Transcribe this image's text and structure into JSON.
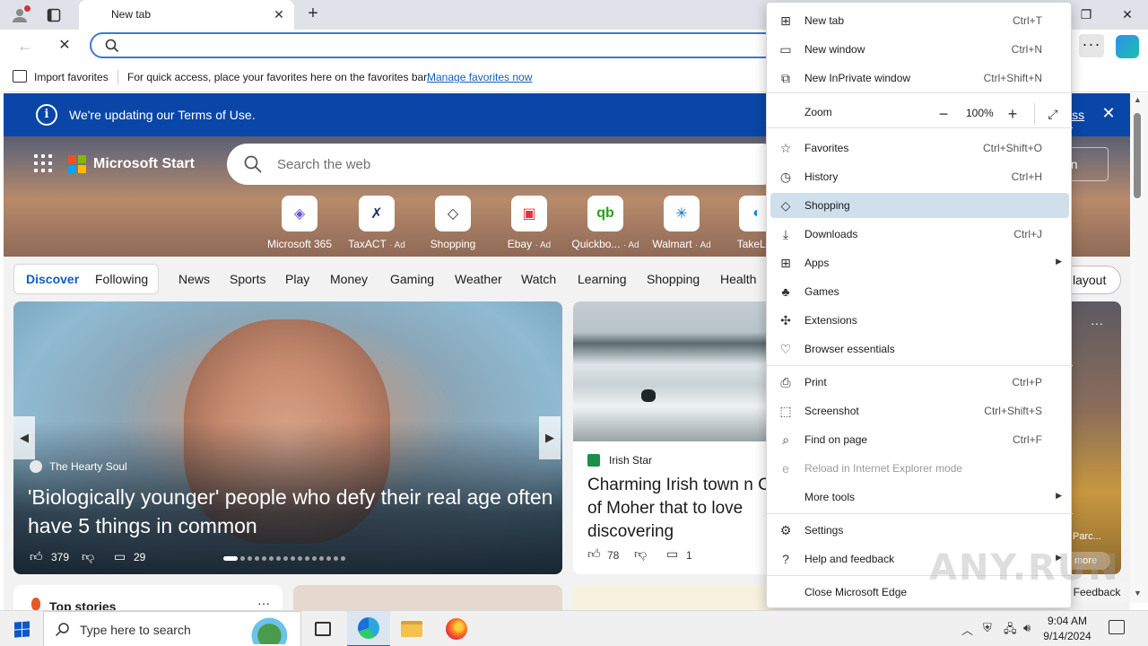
{
  "browser": {
    "tab_title": "New tab",
    "address_value": "",
    "more_label": "···"
  },
  "favorites_bar": {
    "import_label": "Import favorites",
    "hint": "For quick access, place your favorites here on the favorites bar.",
    "manage_link": "Manage favorites now"
  },
  "terms_banner": {
    "text": "We're updating our Terms of Use.",
    "dismiss": "iss"
  },
  "ms_start": {
    "title": "Microsoft Start",
    "search_placeholder": "Search the web",
    "signin": "n in"
  },
  "quick_links": [
    {
      "label": "Microsoft 365",
      "ad": "",
      "glyph": "◈",
      "color": "#6b53d6"
    },
    {
      "label": "TaxACT",
      "ad": "· Ad",
      "glyph": "✗",
      "color": "#13335b"
    },
    {
      "label": "Shopping",
      "ad": "",
      "glyph": "◇",
      "color": "#333333"
    },
    {
      "label": "Ebay",
      "ad": "· Ad",
      "glyph": "▣",
      "color": "#e53238"
    },
    {
      "label": "Quickbo...",
      "ad": "· Ad",
      "glyph": "qb",
      "color": "#2ca01c"
    },
    {
      "label": "Walmart",
      "ad": "· Ad",
      "glyph": "✳",
      "color": "#0071ce"
    },
    {
      "label": "TakeLes",
      "ad": "",
      "glyph": "◐",
      "color": "#1e88e5"
    }
  ],
  "feed_nav": {
    "discover": "Discover",
    "following": "Following",
    "categories": [
      "News",
      "Sports",
      "Play",
      "Money",
      "Gaming",
      "Weather",
      "Watch",
      "Learning",
      "Shopping",
      "Health"
    ],
    "layout_btn": "l layout"
  },
  "hero_card": {
    "source": "The Hearty Soul",
    "title": "'Biologically younger' people who defy their real age often have 5 things in common",
    "likes": "379",
    "comments": "29",
    "slide_count": 16,
    "active_slide": 1
  },
  "card2": {
    "source": "Irish Star",
    "title": "Charming Irish town n Cliffs of Moher that to love discovering",
    "likes": "78",
    "comments": "1"
  },
  "card3": {
    "label": "Parc...",
    "more": "more"
  },
  "bottom": {
    "top_stories": "Top stories",
    "feedback": "Feedback"
  },
  "menu": {
    "items": [
      {
        "label": "New tab",
        "shortcut": "Ctrl+T",
        "icon": "new-tab-icon",
        "glyph": "⊞"
      },
      {
        "label": "New window",
        "shortcut": "Ctrl+N",
        "icon": "new-window-icon",
        "glyph": "▭"
      },
      {
        "label": "New InPrivate window",
        "shortcut": "Ctrl+Shift+N",
        "icon": "inprivate-icon",
        "glyph": "⧉"
      },
      {
        "label": "Zoom",
        "shortcut": "",
        "icon": "",
        "glyph": ""
      },
      {
        "label": "Favorites",
        "shortcut": "Ctrl+Shift+O",
        "icon": "favorites-icon",
        "glyph": "☆"
      },
      {
        "label": "History",
        "shortcut": "Ctrl+H",
        "icon": "history-icon",
        "glyph": "◷"
      },
      {
        "label": "Shopping",
        "shortcut": "",
        "icon": "shopping-tag-icon",
        "glyph": "◇"
      },
      {
        "label": "Downloads",
        "shortcut": "Ctrl+J",
        "icon": "downloads-icon",
        "glyph": "⤓"
      },
      {
        "label": "Apps",
        "shortcut": "",
        "icon": "apps-icon",
        "glyph": "⊞"
      },
      {
        "label": "Games",
        "shortcut": "",
        "icon": "games-icon",
        "glyph": "♣"
      },
      {
        "label": "Extensions",
        "shortcut": "",
        "icon": "extensions-icon",
        "glyph": "✣"
      },
      {
        "label": "Browser essentials",
        "shortcut": "",
        "icon": "heart-pulse-icon",
        "glyph": "♡"
      },
      {
        "label": "Print",
        "shortcut": "Ctrl+P",
        "icon": "print-icon",
        "glyph": "⎙"
      },
      {
        "label": "Screenshot",
        "shortcut": "Ctrl+Shift+S",
        "icon": "screenshot-icon",
        "glyph": "⬚"
      },
      {
        "label": "Find on page",
        "shortcut": "Ctrl+F",
        "icon": "find-icon",
        "glyph": "⌕"
      },
      {
        "label": "Reload in Internet Explorer mode",
        "shortcut": "",
        "icon": "ie-mode-icon",
        "glyph": "e"
      },
      {
        "label": "More tools",
        "shortcut": "",
        "icon": "",
        "glyph": ""
      },
      {
        "label": "Settings",
        "shortcut": "",
        "icon": "settings-gear-icon",
        "glyph": "⚙"
      },
      {
        "label": "Help and feedback",
        "shortcut": "",
        "icon": "help-icon",
        "glyph": "?"
      },
      {
        "label": "Close Microsoft Edge",
        "shortcut": "",
        "icon": "",
        "glyph": ""
      }
    ],
    "zoom_value": "100%",
    "selected": "Shopping"
  },
  "taskbar": {
    "search_placeholder": "Type here to search",
    "time": "9:04 AM",
    "date": "9/14/2024"
  },
  "watermark": "ANY.RUN",
  "colors": {
    "accent": "#0f5ec2",
    "banner": "#0a46a7",
    "menu_selected": "#cfdfeb"
  }
}
